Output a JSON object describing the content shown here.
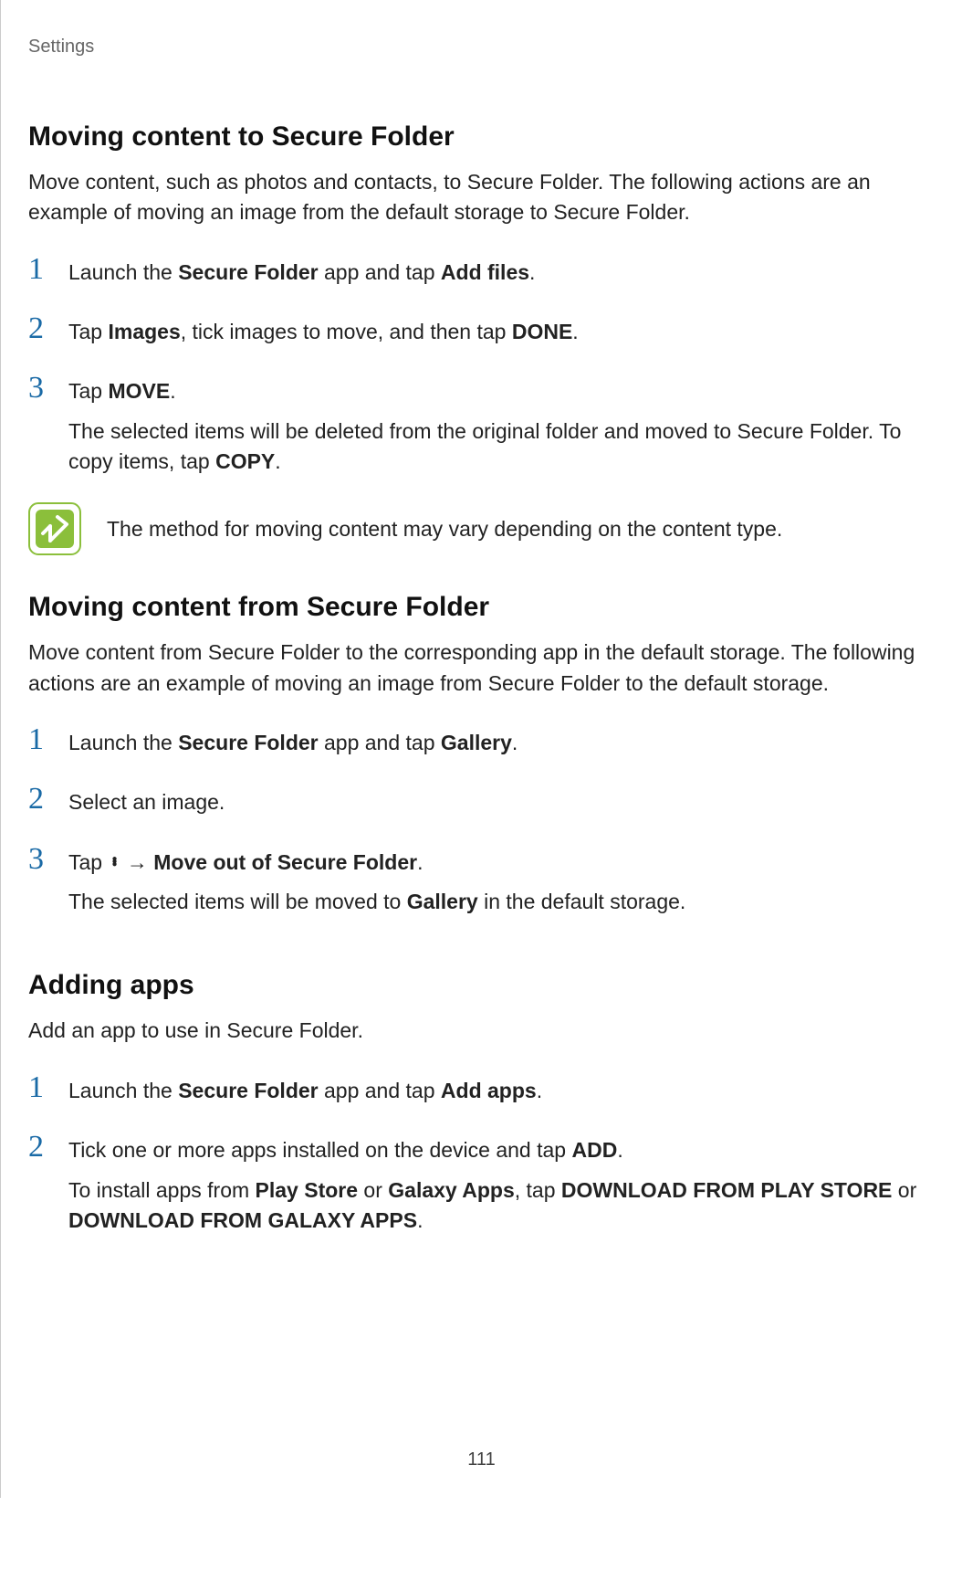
{
  "breadcrumb": "Settings",
  "page_number": "111",
  "sec1": {
    "h": "Moving content to Secure Folder",
    "intro": "Move content, such as photos and contacts, to Secure Folder. The following actions are an example of moving an image from the default storage to Secure Folder.",
    "s1": {
      "n": "1",
      "a": "Launch the ",
      "b": "Secure Folder",
      "c": " app and tap ",
      "d": "Add files",
      "e": "."
    },
    "s2": {
      "n": "2",
      "a": "Tap ",
      "b": "Images",
      "c": ", tick images to move, and then tap ",
      "d": "DONE",
      "e": "."
    },
    "s3": {
      "n": "3",
      "a": "Tap ",
      "b": "MOVE",
      "c": ".",
      "p2a": "The selected items will be deleted from the original folder and moved to Secure Folder. To copy items, tap ",
      "p2b": "COPY",
      "p2c": "."
    },
    "note": "The method for moving content may vary depending on the content type."
  },
  "sec2": {
    "h": "Moving content from Secure Folder",
    "intro": "Move content from Secure Folder to the corresponding app in the default storage. The following actions are an example of moving an image from Secure Folder to the default storage.",
    "s1": {
      "n": "1",
      "a": "Launch the ",
      "b": "Secure Folder",
      "c": " app and tap ",
      "d": "Gallery",
      "e": "."
    },
    "s2": {
      "n": "2",
      "a": "Select an image."
    },
    "s3": {
      "n": "3",
      "a": "Tap ",
      "arrow": " → ",
      "b": "Move out of Secure Folder",
      "c": ".",
      "p2a": "The selected items will be moved to ",
      "p2b": "Gallery",
      "p2c": " in the default storage."
    }
  },
  "sec3": {
    "h": "Adding apps",
    "intro": "Add an app to use in Secure Folder.",
    "s1": {
      "n": "1",
      "a": "Launch the ",
      "b": "Secure Folder",
      "c": " app and tap ",
      "d": "Add apps",
      "e": "."
    },
    "s2": {
      "n": "2",
      "a": "Tick one or more apps installed on the device and tap ",
      "b": "ADD",
      "c": ".",
      "p2a": "To install apps from ",
      "p2b": "Play Store",
      "p2c": " or ",
      "p2d": "Galaxy Apps",
      "p2e": ", tap ",
      "p2f": "DOWNLOAD FROM PLAY STORE",
      "p2g": " or ",
      "p2h": "DOWNLOAD FROM GALAXY APPS",
      "p2i": "."
    }
  }
}
